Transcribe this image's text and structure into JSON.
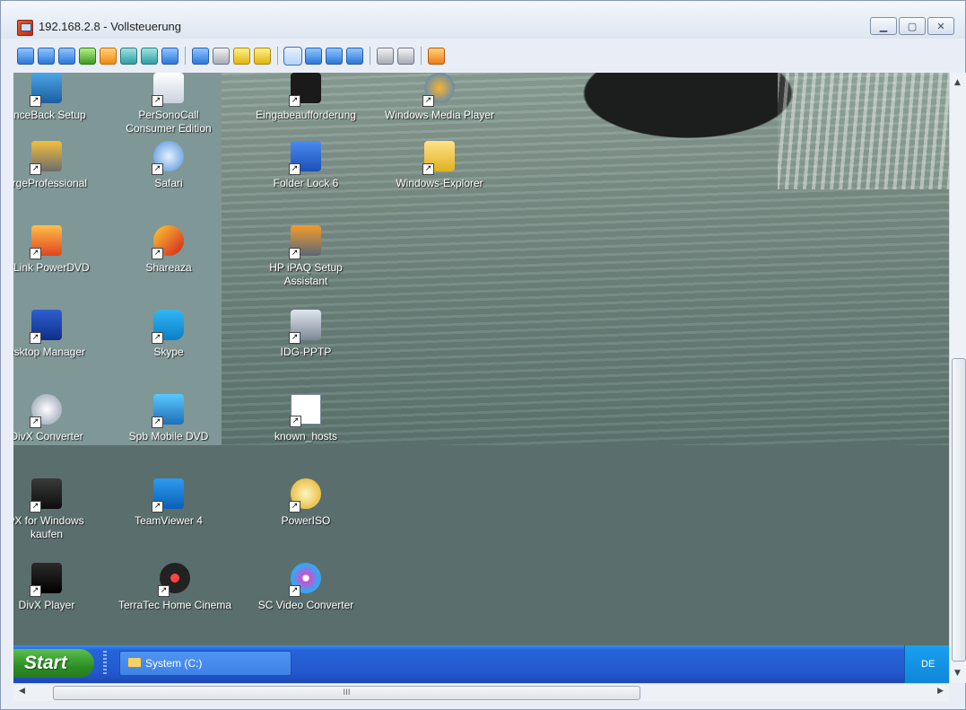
{
  "window": {
    "title": "192.168.2.8 - Vollsteuerung"
  },
  "desktop_icons": [
    {
      "label": "unceBack Setup"
    },
    {
      "label": "PerSonoCall Consumer Edition"
    },
    {
      "label": "Eingabeaufforderung"
    },
    {
      "label": "Windows Media Player"
    },
    {
      "label": "argeProfessional"
    },
    {
      "label": "Safari"
    },
    {
      "label": "Folder Lock 6"
    },
    {
      "label": "Windows-Explorer"
    },
    {
      "label": "erLink PowerDVD"
    },
    {
      "label": "Shareaza"
    },
    {
      "label": "HP iPAQ Setup Assistant"
    },
    {
      "label": "esktop Manager"
    },
    {
      "label": "Skype"
    },
    {
      "label": "IDG-PPTP"
    },
    {
      "label": "DivX Converter"
    },
    {
      "label": "Spb Mobile DVD"
    },
    {
      "label": "known_hosts"
    },
    {
      "label": "vX for Windows kaufen"
    },
    {
      "label": "TeamViewer 4"
    },
    {
      "label": "PowerISO"
    },
    {
      "label": "DivX Player"
    },
    {
      "label": "TerraTec Home Cinema"
    },
    {
      "label": "SC Video Converter"
    }
  ],
  "taskbar": {
    "start_label": "Start",
    "task_label": "System (C:)",
    "language": "DE"
  },
  "scrollbar": {
    "grip": "III"
  }
}
